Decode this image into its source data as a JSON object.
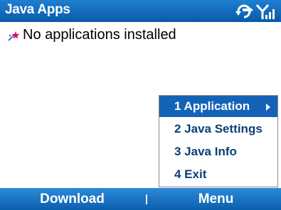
{
  "title_bar": {
    "title": "Java Apps",
    "icons": [
      "connectivity-icon",
      "signal-strength-icon"
    ]
  },
  "content": {
    "empty_message": "No applications installed",
    "empty_icon": "sparkle-star-icon"
  },
  "menu": {
    "items": [
      {
        "label": "1 Application",
        "selected": true,
        "has_submenu": true
      },
      {
        "label": "2 Java Settings",
        "selected": false,
        "has_submenu": false
      },
      {
        "label": "3 Java Info",
        "selected": false,
        "has_submenu": false
      },
      {
        "label": "4 Exit",
        "selected": false,
        "has_submenu": false
      }
    ]
  },
  "softkeys": {
    "left": "Download",
    "right": "Menu"
  },
  "colors": {
    "title_bar": "#0a5aa8",
    "softkey_bar": "#0c5eae",
    "menu_selected": "#1563b8",
    "menu_text": "#0a3f7a"
  }
}
